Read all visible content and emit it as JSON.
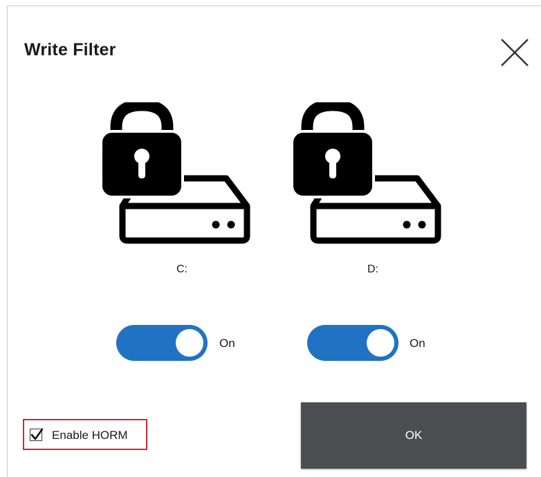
{
  "dialog": {
    "title": "Write Filter",
    "close_icon": "close-icon"
  },
  "drives": [
    {
      "label": "C:",
      "icon": "locked-drive-icon",
      "toggle_state": "On",
      "toggle_on": true
    },
    {
      "label": "D:",
      "icon": "locked-drive-icon",
      "toggle_state": "On",
      "toggle_on": true
    }
  ],
  "horm": {
    "label": "Enable HORM",
    "checked": true,
    "highlight_color": "#d0272f"
  },
  "ok_button": {
    "label": "OK"
  },
  "colors": {
    "toggle_on": "#1f73c2",
    "ok_button_bg": "#4c4d50"
  }
}
